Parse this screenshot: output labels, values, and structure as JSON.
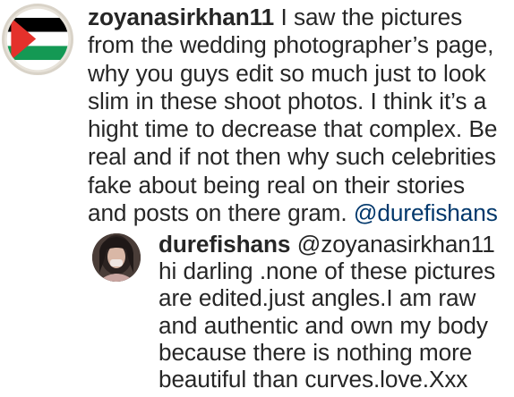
{
  "comment": {
    "avatar": "palestine-flag-avatar",
    "username": "zoyanasirkhan11",
    "lines": [
      " I saw the pictures",
      "from the wedding photographer’s page,",
      "why you guys edit so much just to look",
      "slim in these shoot photos. I think it’s a",
      "hight time to decrease that complex. Be",
      "real and if not then why such celebrities",
      "fake about being real on their stories",
      "and posts on there gram. "
    ],
    "mention": "@durefishans"
  },
  "reply": {
    "avatar": "profile-photo-avatar",
    "username": "durefishans",
    "mention": " @zoyanasirkhan11",
    "lines": [
      "hi darling .none of these pictures",
      "are edited.just angles.I am raw",
      "and authentic and own my body",
      "because there is nothing more",
      "beautiful than curves.love.Xxx"
    ]
  },
  "colors": {
    "text": "#262626",
    "mention": "#00376b",
    "flag_black": "#000000",
    "flag_white": "#ffffff",
    "flag_green": "#149954",
    "flag_red": "#e4312b"
  }
}
